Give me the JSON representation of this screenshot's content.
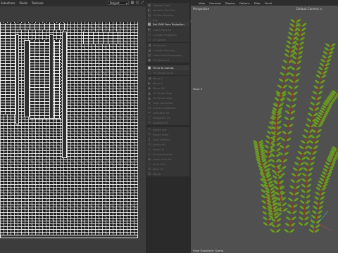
{
  "uv_editor": {
    "menu": [
      "Selections",
      "Pixels",
      "Textures"
    ],
    "project_select": "Project"
  },
  "command_list": {
    "items": [
      {
        "label": "Optimal Cubic",
        "state": "disabled"
      },
      {
        "label": "Realistic (Old Set)",
        "state": "disabled"
      },
      {
        "label": "UV Box Mapping",
        "state": "disabled"
      },
      {
        "label": "Box",
        "state": "disabled"
      },
      {
        "label": "Set UVW From Projection",
        "state": "active"
      },
      {
        "label": "Cubic Paint All",
        "state": "disabled"
      },
      {
        "label": "Cylinder Projection",
        "state": "disabled"
      },
      {
        "label": "UV Sphere",
        "state": "disabled"
      },
      {
        "label": "UV Frontal",
        "state": "disabled"
      },
      {
        "label": "Cylinder Mapping",
        "state": "disabled"
      },
      {
        "label": "Cubic Paint Remapping",
        "state": "disabled"
      },
      {
        "label": "UV Spherical",
        "state": "disabled"
      },
      {
        "label": "Fit UV to Canvas",
        "state": "active"
      },
      {
        "label": "Fit Canvas to UV",
        "state": "disabled"
      },
      {
        "label": "Mirror U",
        "state": "disabled"
      },
      {
        "label": "Mirror V",
        "state": "disabled"
      },
      {
        "label": "Mirror UV",
        "state": "disabled"
      },
      {
        "label": "UV Terrain Map",
        "state": "disabled"
      },
      {
        "label": "UV Terrain Map",
        "state": "disabled"
      },
      {
        "label": "Align Horizontal",
        "state": "disabled"
      },
      {
        "label": "Stretch to Extents",
        "state": "disabled"
      },
      {
        "label": "Unstretch UV",
        "state": "disabled"
      },
      {
        "label": "Straighten UV",
        "state": "disabled"
      },
      {
        "label": "Equalize UV",
        "state": "disabled"
      },
      {
        "label": "Rotate Left",
        "state": "disabled"
      },
      {
        "label": "Rotate Right",
        "state": "disabled"
      },
      {
        "label": "Align Vertical",
        "state": "disabled"
      },
      {
        "label": "Rotate 90°",
        "state": "disabled"
      },
      {
        "label": "Relax UV",
        "state": "disabled"
      },
      {
        "label": "Fix Equalization",
        "state": "disabled"
      },
      {
        "label": "Quad Chart UV",
        "state": "disabled"
      },
      {
        "label": "Snap UVs",
        "state": "disabled"
      },
      {
        "label": "Weld UV",
        "state": "disabled"
      },
      {
        "label": "Merge",
        "state": "disabled"
      }
    ]
  },
  "viewport": {
    "menu": [
      "View",
      "Cameras",
      "Display",
      "Options",
      "Filter",
      "Panel"
    ],
    "view_name": "Perspective",
    "camera": "Default Camera ⊙",
    "move_label": "Move ⇕",
    "footer": "View Transform: Scene"
  },
  "colors": {
    "accent_active": "#3b3b3b",
    "plant_green": "#6c9a2e",
    "plant_red": "#8a3a24"
  }
}
